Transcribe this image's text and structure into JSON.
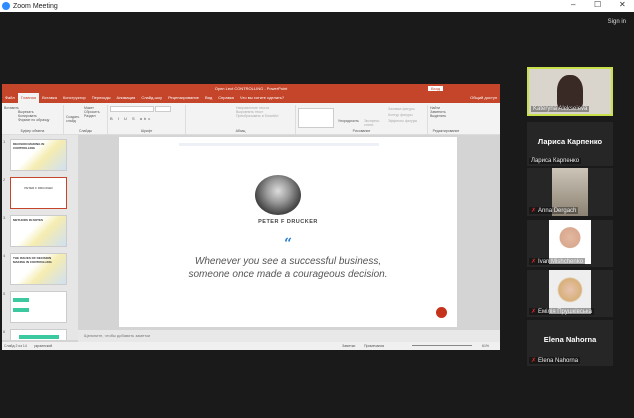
{
  "window": {
    "title": "Zoom Meeting",
    "minimize": "–",
    "maximize": "☐",
    "close": "✕",
    "sign_in": "Sign in"
  },
  "ppt": {
    "title": "Open Lect CONTROLLING - PowerPoint",
    "login": "Вход",
    "tabs": [
      "Файл",
      "Главная",
      "Вставка",
      "Конструктор",
      "Переходы",
      "Анимация",
      "Слайд-шоу",
      "Рецензирование",
      "Вид",
      "Справка",
      "Что вы хотите сделать?"
    ],
    "share": "Общий доступ",
    "ribbon": {
      "clipboard": {
        "label": "Буфер обмена",
        "paste": "Вставить",
        "cut": "Вырезать",
        "copy": "Копировать",
        "format": "Формат по образцу"
      },
      "slides": {
        "label": "Слайды",
        "new": "Создать слайд",
        "layout": "Макет",
        "reset": "Сбросить",
        "section": "Раздел"
      },
      "font": {
        "label": "Шрифт"
      },
      "paragraph": {
        "label": "Абзац",
        "dir": "Направление текста",
        "align": "Выровнять текст",
        "smartart": "Преобразовать в SmartArt"
      },
      "drawing": {
        "label": "Рисование",
        "arrange": "Упорядочить",
        "styles": "Экспресс-стили",
        "fill": "Заливка фигуры",
        "outline": "Контур фигуры",
        "effects": "Эффекты фигуры"
      },
      "editing": {
        "label": "Редактирование",
        "find": "Найти",
        "replace": "Заменить",
        "select": "Выделить"
      }
    },
    "thumbnails": [
      {
        "num": "1",
        "text": "DECISION MAKING IN CONTROLLING"
      },
      {
        "num": "2",
        "text": "PETER F DRUCKER"
      },
      {
        "num": "3",
        "text": "METHODS IN NOTES"
      },
      {
        "num": "4",
        "text": "THE ISSUES OF DECISION MAKING IN CONTROLLING"
      },
      {
        "num": "5",
        "text": ""
      },
      {
        "num": "6",
        "text": ""
      }
    ],
    "slide": {
      "author": "PETER F DRUCKER",
      "quote_mark": "“",
      "quote": "Whenever you see a successful business, someone once made a courageous decision."
    },
    "notes_placeholder": "Щелкните, чтобы добавить заметки",
    "status": {
      "slide": "Слайд 2 из 14",
      "lang": "украинский",
      "notes": "Заметки",
      "comments": "Примечания",
      "zoom": "61%"
    }
  },
  "participants": [
    {
      "name": "Kateryna Alekseieva",
      "muted": false,
      "video": true,
      "active": true
    },
    {
      "name": "Лариса Карпенко",
      "big": "Лариса Карпенко",
      "muted": false,
      "video": false
    },
    {
      "name": "Anna Dergach",
      "muted": true,
      "video": true
    },
    {
      "name": "Ivan Mishchenko",
      "muted": true,
      "video": true
    },
    {
      "name": "Емілія Прушківська",
      "muted": true,
      "video": true
    },
    {
      "name": "Elena Nahorna",
      "big": "Elena Nahorna",
      "muted": true,
      "video": false
    }
  ],
  "colors": {
    "ppt": "#c4452a",
    "active_speaker": "#c8e04a",
    "zoom_blue": "#2d8cff"
  }
}
